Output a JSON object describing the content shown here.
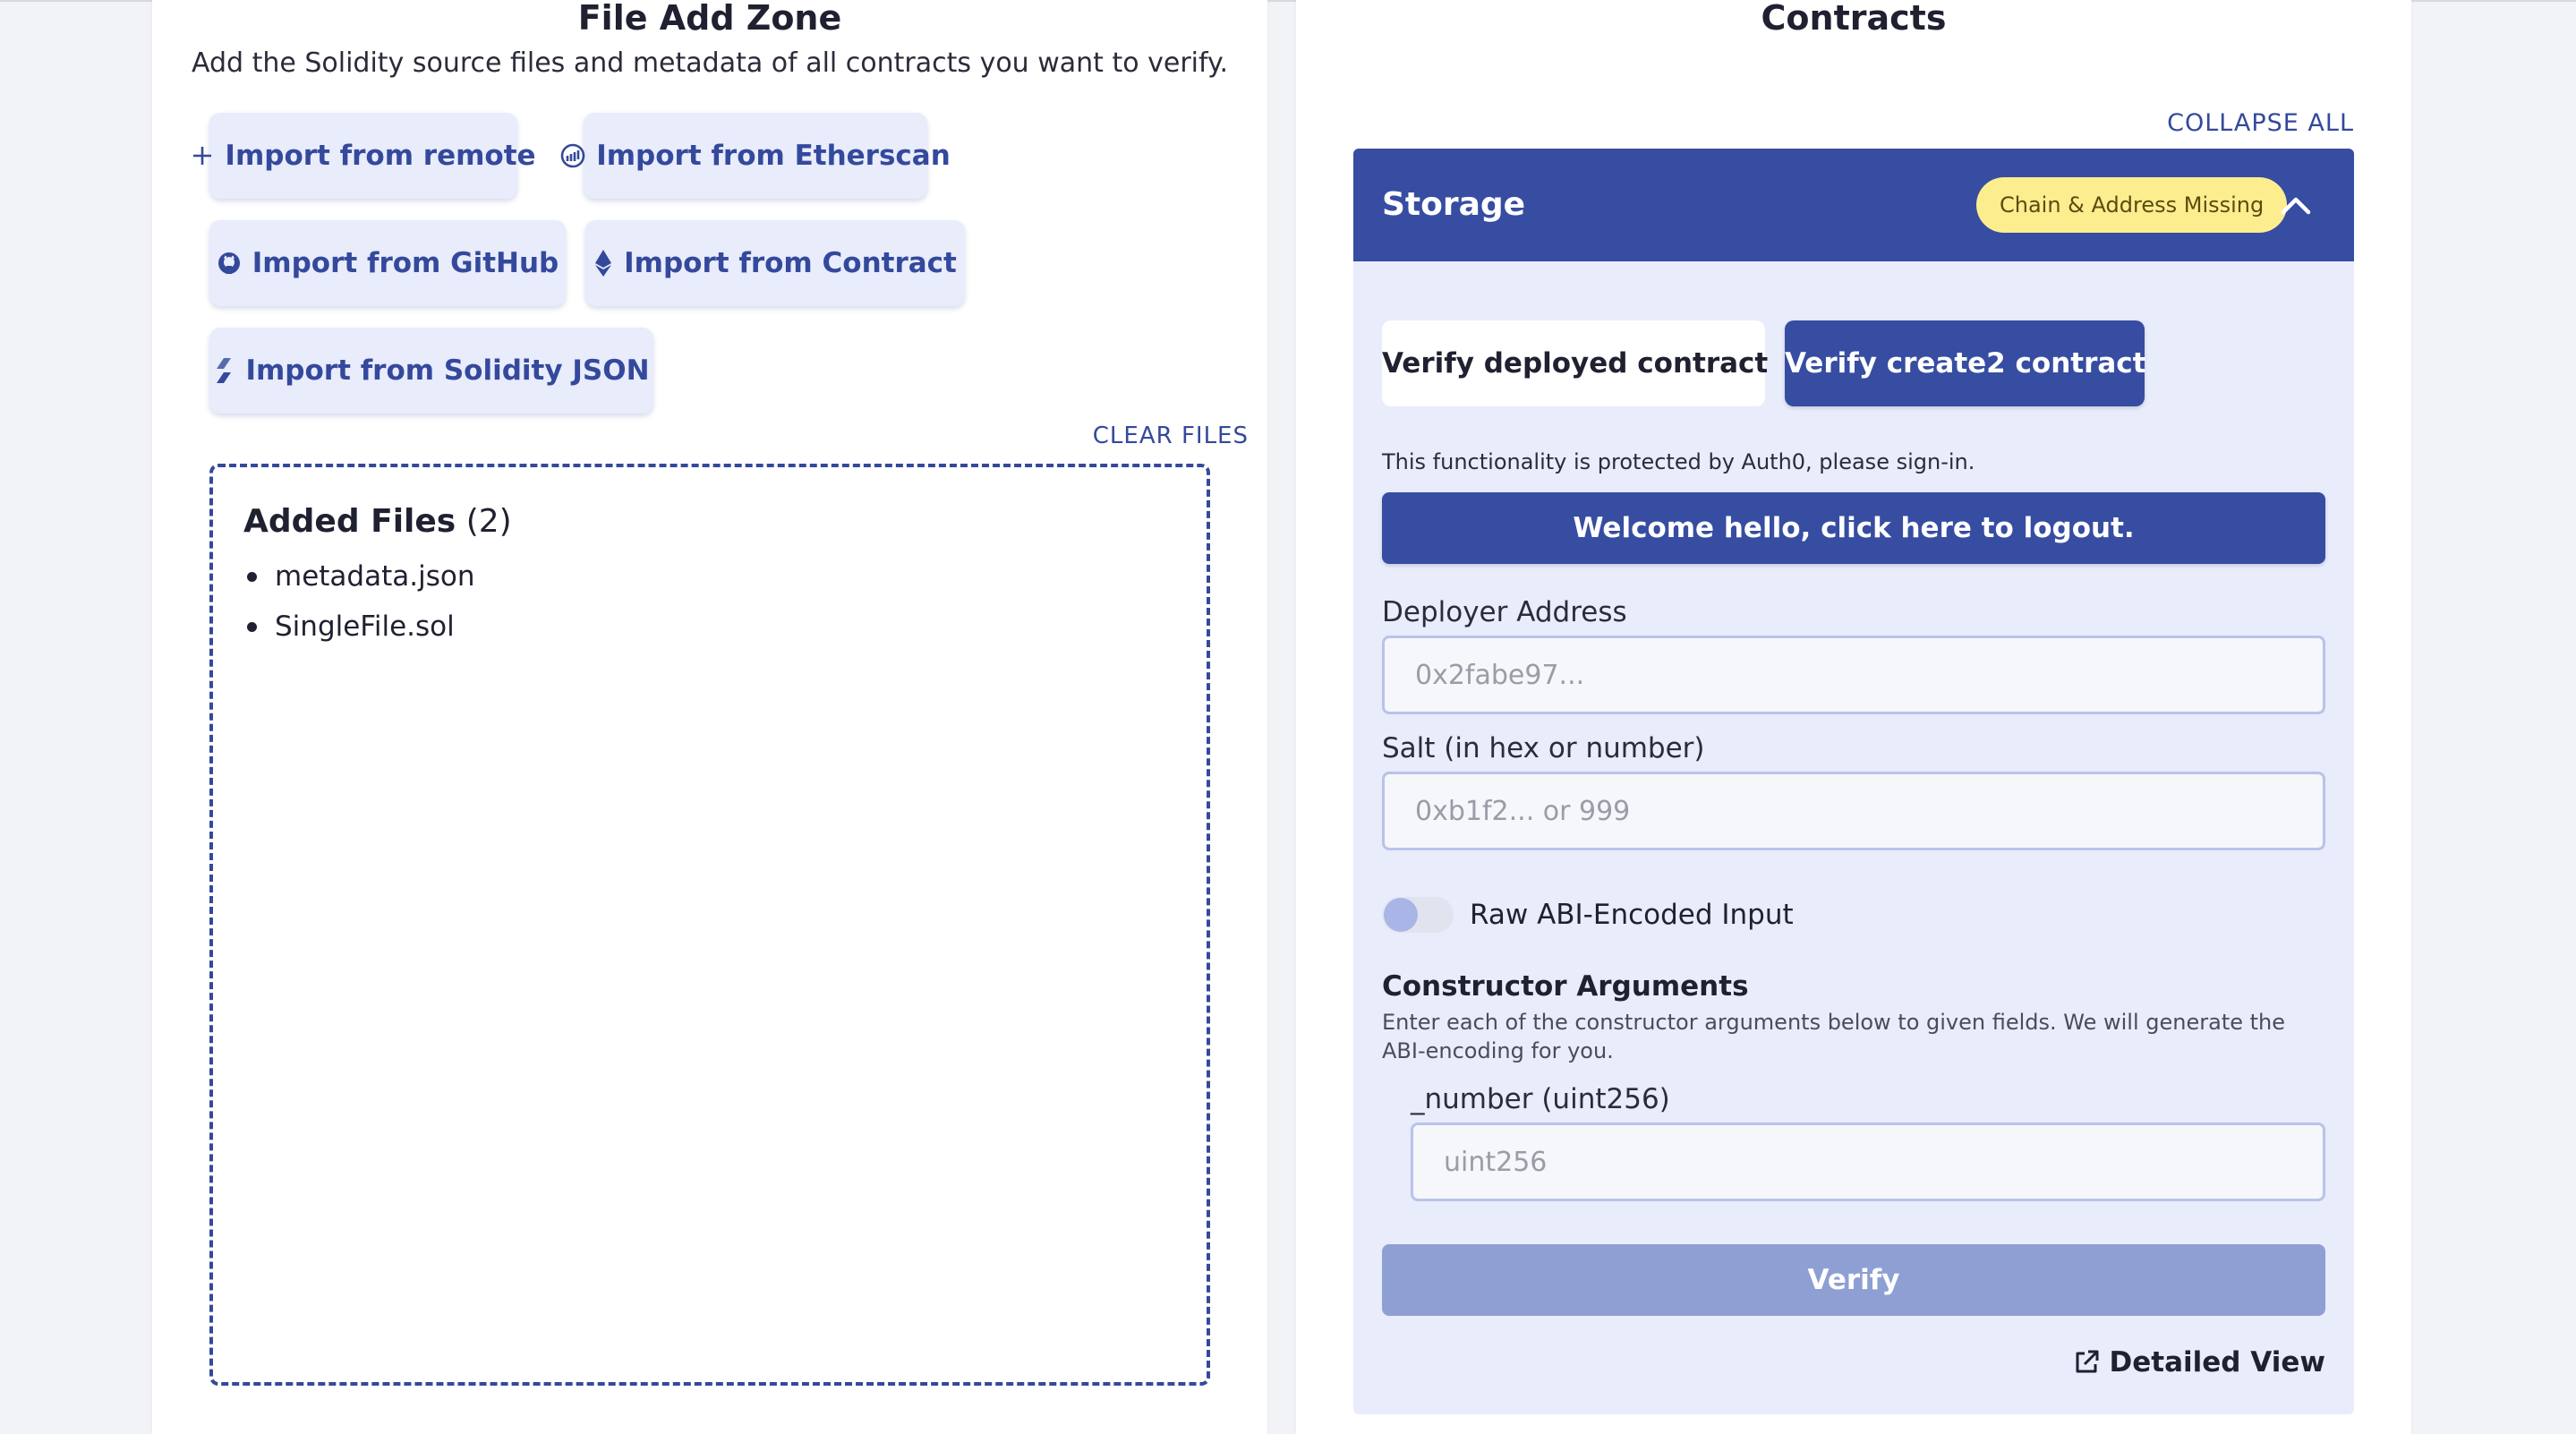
{
  "file_add_zone": {
    "title": "File Add Zone",
    "subtitle": "Add the Solidity source files and metadata of all contracts you want to verify.",
    "import_buttons": [
      {
        "label": "Import from remote",
        "icon": "plus-icon"
      },
      {
        "label": "Import from Etherscan",
        "icon": "etherscan-icon"
      },
      {
        "label": "Import from GitHub",
        "icon": "github-icon"
      },
      {
        "label": "Import from Contract",
        "icon": "ethereum-icon"
      },
      {
        "label": "Import from Solidity JSON",
        "icon": "solidity-icon"
      }
    ],
    "clear_files": "CLEAR FILES",
    "added_files_title": "Added Files",
    "added_files_count": "(2)",
    "files": [
      "metadata.json",
      "SingleFile.sol"
    ]
  },
  "contracts": {
    "title": "Contracts",
    "collapse_all": "COLLAPSE ALL",
    "card": {
      "name": "Storage",
      "badge": "Chain & Address Missing",
      "mode_deployed": "Verify deployed contract",
      "mode_create2": "Verify create2 contract",
      "auth_note": "This functionality is protected by Auth0, please sign-in.",
      "logout_button": "Welcome hello, click here to logout.",
      "deployer_label": "Deployer Address",
      "deployer_placeholder": "0x2fabe97...",
      "salt_label": "Salt (in hex or number)",
      "salt_placeholder": "0xb1f2... or 999",
      "raw_abi_label": "Raw ABI-Encoded Input",
      "constructor_title": "Constructor Arguments",
      "constructor_desc": "Enter each of the constructor arguments below to given fields. We will generate the ABI-encoding for you.",
      "arg_label": "_number (uint256)",
      "arg_placeholder": "uint256",
      "verify_button": "Verify",
      "detailed_view": "Detailed View"
    }
  },
  "colors": {
    "primary": "#374da2",
    "button_bg": "#e8ecfb",
    "badge_bg": "#fcee8e",
    "verify_disabled": "#8e9fd3"
  }
}
